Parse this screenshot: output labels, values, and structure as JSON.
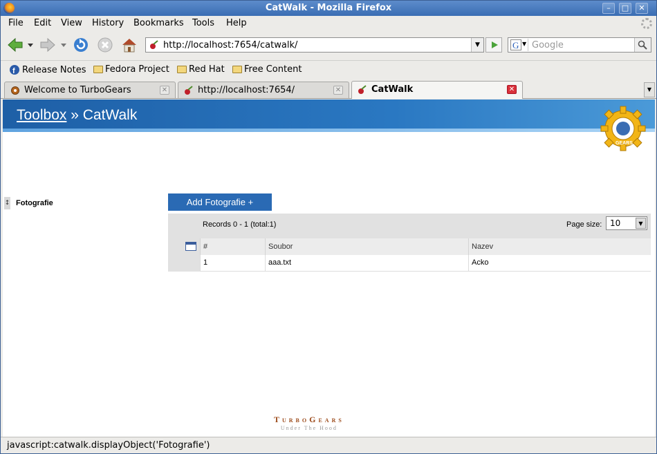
{
  "window": {
    "title": "CatWalk - Mozilla Firefox"
  },
  "menu": [
    "File",
    "Edit",
    "View",
    "History",
    "Bookmarks",
    "Tools",
    "Help"
  ],
  "url": {
    "value": "http://localhost:7654/catwalk/"
  },
  "search": {
    "placeholder": "Google"
  },
  "bookmarks": [
    "Release Notes",
    "Fedora Project",
    "Red Hat",
    "Free Content"
  ],
  "tabs": [
    {
      "label": "Welcome to TurboGears",
      "active": false
    },
    {
      "label": "http://localhost:7654/",
      "active": false
    },
    {
      "label": "CatWalk",
      "active": true
    }
  ],
  "page": {
    "breadcrumb_link": "Toolbox",
    "breadcrumb_sep": "»",
    "breadcrumb_current": "CatWalk",
    "sidebar_handle": "↕",
    "sidebar_item": "Fotografie",
    "add_button": "Add Fotografie +",
    "records_text": "Records 0 - 1 (total:1)",
    "page_size_label": "Page size:",
    "page_size_value": "10",
    "columns": [
      "#",
      "Soubor",
      "Nazev"
    ],
    "rows": [
      [
        "1",
        "aaa.txt",
        "Acko"
      ]
    ],
    "footer_name": "TurboGears",
    "footer_tag": "Under The Hood",
    "logo_text": "GEARS"
  },
  "status": {
    "text": "javascript:catwalk.displayObject('Fotografie')"
  },
  "colors": {
    "accent": "#2a6ab4",
    "header": "#1e5fa6"
  }
}
